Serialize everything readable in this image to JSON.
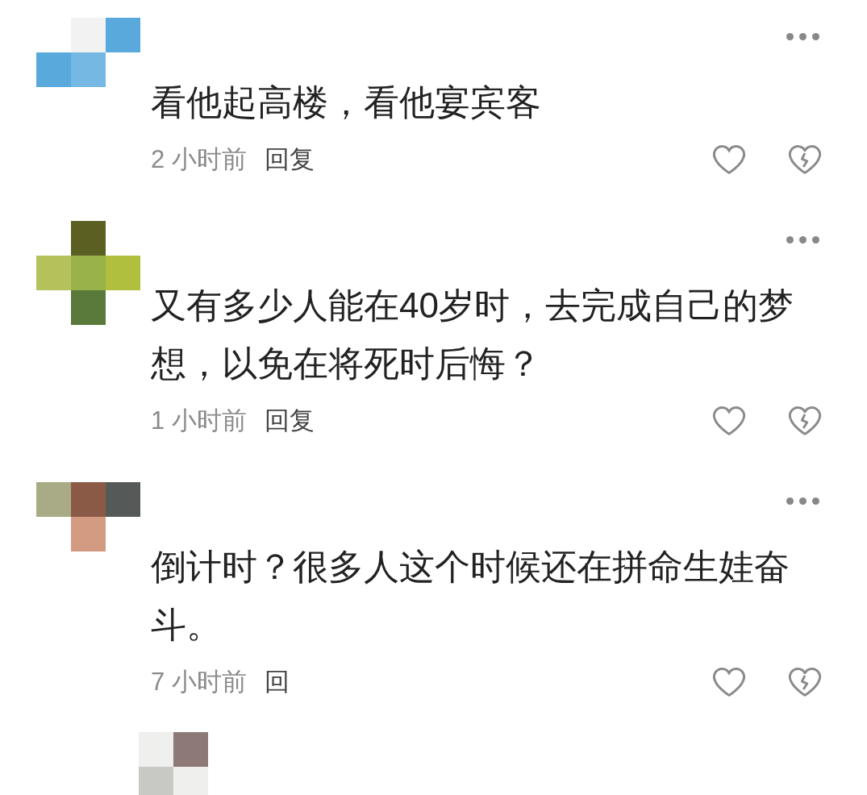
{
  "comments": [
    {
      "kind": "comment",
      "text": "看他起高楼，看他宴宾客",
      "time": "2 小时前",
      "reply": "回复"
    },
    {
      "kind": "comment",
      "text": "又有多少人能在40岁时，去完成自己的梦想，以免在将死时后悔？",
      "time": "1 小时前",
      "reply": "回复"
    },
    {
      "kind": "comment",
      "text": "倒计时？很多人这个时候还在拼命生娃奋斗。",
      "time": "7 小时前",
      "reply": "回"
    },
    {
      "kind": "nested"
    }
  ]
}
